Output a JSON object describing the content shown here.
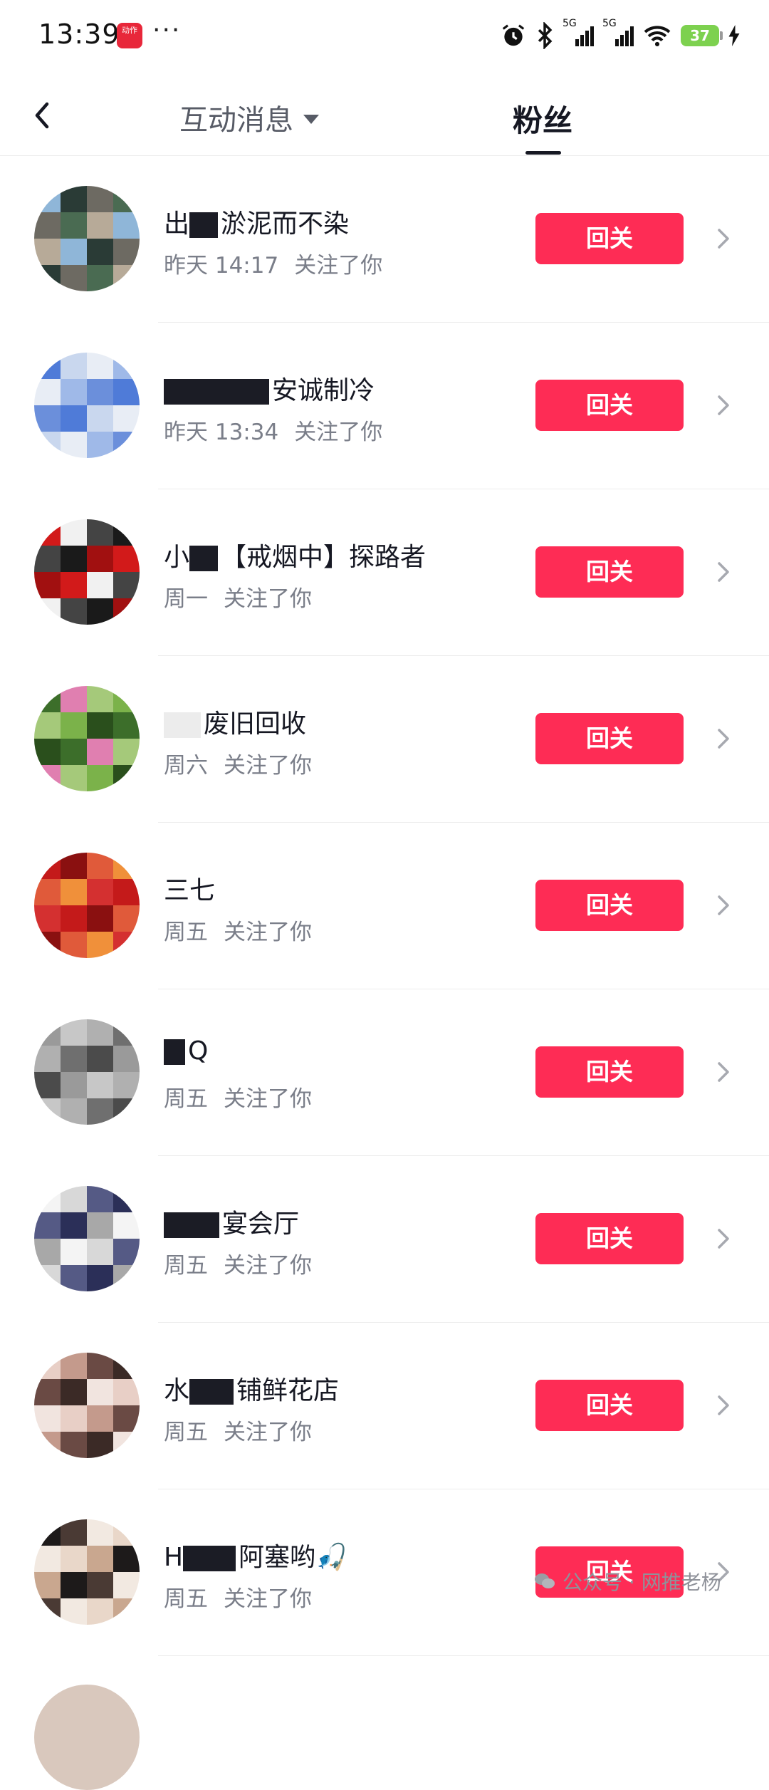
{
  "status_bar": {
    "time": "13:39",
    "app_badge": "动作",
    "more": "···",
    "signal1_label": "5G",
    "signal2_label": "5G",
    "battery": "37",
    "icons": [
      "alarm-icon",
      "bluetooth-icon",
      "signal-icon",
      "signal-icon",
      "wifi-icon",
      "battery-icon",
      "charging-icon"
    ]
  },
  "nav": {
    "tab_interaction": "互动消息",
    "tab_fans": "粉丝"
  },
  "follow_label": "回关",
  "followed_text": "关注了你",
  "rows": [
    {
      "name_prefix": "出",
      "name": "淤泥而不染",
      "time": "昨天 14:17",
      "avatar_colors": [
        "#8fb6d8",
        "#4a6b52",
        "#2a3b36",
        "#b7aa98",
        "#6d6a62"
      ]
    },
    {
      "name_prefix": "",
      "name": "安诚制冷",
      "time": "昨天 13:34",
      "avatar_colors": [
        "#4f7bd8",
        "#9fb9e8",
        "#c9d7ee",
        "#6b8fdb",
        "#e8edf5"
      ]
    },
    {
      "name_prefix": "小",
      "name": "【戒烟中】探路者",
      "time": "周一",
      "avatar_colors": [
        "#d21a1a",
        "#1a1a1a",
        "#f1f1f1",
        "#a11010",
        "#444444"
      ]
    },
    {
      "name_prefix": "",
      "name": "废旧回收",
      "time": "周六",
      "avatar_colors": [
        "#3c6e2a",
        "#7bb24a",
        "#e07fb0",
        "#2a4f1c",
        "#a5c97a"
      ]
    },
    {
      "name_prefix": "三",
      "name": "七",
      "time": "周五",
      "avatar_colors": [
        "#c41a1a",
        "#f0903a",
        "#8a1010",
        "#d43030",
        "#e05a3a"
      ]
    },
    {
      "name_prefix": "",
      "name": "Q",
      "time": "周五",
      "avatar_colors": [
        "#9a9a9a",
        "#6f6f6f",
        "#c7c7c7",
        "#4b4b4b",
        "#b0b0b0"
      ]
    },
    {
      "name_prefix": "",
      "name": "宴会厅",
      "time": "周五",
      "avatar_colors": [
        "#f4f4f4",
        "#2b2f58",
        "#d8d8d8",
        "#a8a8a8",
        "#555a85"
      ]
    },
    {
      "name_prefix": "水",
      "name": "铺鲜花店",
      "time": "周五",
      "avatar_colors": [
        "#e8cfc6",
        "#3b2a26",
        "#c49a8c",
        "#f1e4df",
        "#6a4a44"
      ]
    },
    {
      "name_prefix": "H",
      "name": "阿塞哟🎣",
      "time": "周五",
      "avatar_colors": [
        "#1d1a1a",
        "#e9d7c9",
        "#4a3a34",
        "#c9a78f",
        "#f2e9e1"
      ]
    }
  ],
  "watermark": "公众号 · 网推老杨"
}
